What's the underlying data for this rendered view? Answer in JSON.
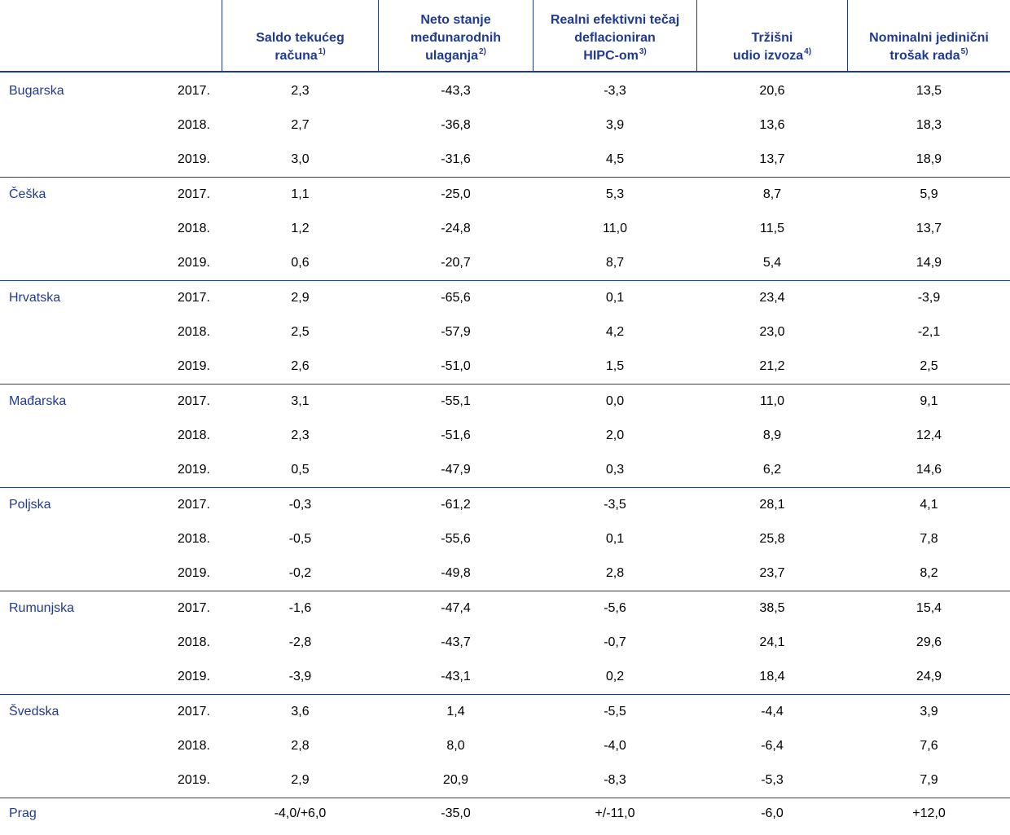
{
  "table": {
    "columns": [
      {
        "lines": [
          "Saldo tekućeg",
          "računa"
        ],
        "note": "1)"
      },
      {
        "lines": [
          "Neto stanje",
          "međunarodnih",
          "ulaganja"
        ],
        "note": "2)"
      },
      {
        "lines": [
          "Realni efektivni tečaj",
          "deflacioniran",
          "HIPC-om"
        ],
        "note": "3)"
      },
      {
        "lines": [
          "Tržišni",
          "udio izvoza"
        ],
        "note": "4)"
      },
      {
        "lines": [
          "Nominalni jedinični",
          "trošak rada"
        ],
        "note": "5)"
      }
    ],
    "groups": [
      {
        "country": "Bugarska",
        "rows": [
          {
            "year": "2017.",
            "values": [
              "2,3",
              "-43,3",
              "-3,3",
              "20,6",
              "13,5"
            ]
          },
          {
            "year": "2018.",
            "values": [
              "2,7",
              "-36,8",
              "3,9",
              "13,6",
              "18,3"
            ]
          },
          {
            "year": "2019.",
            "values": [
              "3,0",
              "-31,6",
              "4,5",
              "13,7",
              "18,9"
            ]
          }
        ]
      },
      {
        "country": "Češka",
        "rows": [
          {
            "year": "2017.",
            "values": [
              "1,1",
              "-25,0",
              "5,3",
              "8,7",
              "5,9"
            ]
          },
          {
            "year": "2018.",
            "values": [
              "1,2",
              "-24,8",
              "11,0",
              "11,5",
              "13,7"
            ]
          },
          {
            "year": "2019.",
            "values": [
              "0,6",
              "-20,7",
              "8,7",
              "5,4",
              "14,9"
            ]
          }
        ]
      },
      {
        "country": "Hrvatska",
        "rows": [
          {
            "year": "2017.",
            "values": [
              "2,9",
              "-65,6",
              "0,1",
              "23,4",
              "-3,9"
            ]
          },
          {
            "year": "2018.",
            "values": [
              "2,5",
              "-57,9",
              "4,2",
              "23,0",
              "-2,1"
            ]
          },
          {
            "year": "2019.",
            "values": [
              "2,6",
              "-51,0",
              "1,5",
              "21,2",
              "2,5"
            ]
          }
        ]
      },
      {
        "country": "Mađarska",
        "rows": [
          {
            "year": "2017.",
            "values": [
              "3,1",
              "-55,1",
              "0,0",
              "11,0",
              "9,1"
            ]
          },
          {
            "year": "2018.",
            "values": [
              "2,3",
              "-51,6",
              "2,0",
              "8,9",
              "12,4"
            ]
          },
          {
            "year": "2019.",
            "values": [
              "0,5",
              "-47,9",
              "0,3",
              "6,2",
              "14,6"
            ]
          }
        ]
      },
      {
        "country": "Poljska",
        "rows": [
          {
            "year": "2017.",
            "values": [
              "-0,3",
              "-61,2",
              "-3,5",
              "28,1",
              "4,1"
            ]
          },
          {
            "year": "2018.",
            "values": [
              "-0,5",
              "-55,6",
              "0,1",
              "25,8",
              "7,8"
            ]
          },
          {
            "year": "2019.",
            "values": [
              "-0,2",
              "-49,8",
              "2,8",
              "23,7",
              "8,2"
            ]
          }
        ]
      },
      {
        "country": "Rumunjska",
        "rows": [
          {
            "year": "2017.",
            "values": [
              "-1,6",
              "-47,4",
              "-5,6",
              "38,5",
              "15,4"
            ]
          },
          {
            "year": "2018.",
            "values": [
              "-2,8",
              "-43,7",
              "-0,7",
              "24,1",
              "29,6"
            ]
          },
          {
            "year": "2019.",
            "values": [
              "-3,9",
              "-43,1",
              "0,2",
              "18,4",
              "24,9"
            ]
          }
        ]
      },
      {
        "country": "Švedska",
        "rows": [
          {
            "year": "2017.",
            "values": [
              "3,6",
              "1,4",
              "-5,5",
              "-4,4",
              "3,9"
            ]
          },
          {
            "year": "2018.",
            "values": [
              "2,8",
              "8,0",
              "-4,0",
              "-6,4",
              "7,6"
            ]
          },
          {
            "year": "2019.",
            "values": [
              "2,9",
              "20,9",
              "-8,3",
              "-5,3",
              "7,9"
            ]
          }
        ]
      }
    ],
    "threshold": {
      "label": "Prag",
      "values": [
        "-4,0/+6,0",
        "-35,0",
        "+/-11,0",
        "-6,0",
        "+12,0"
      ]
    }
  }
}
